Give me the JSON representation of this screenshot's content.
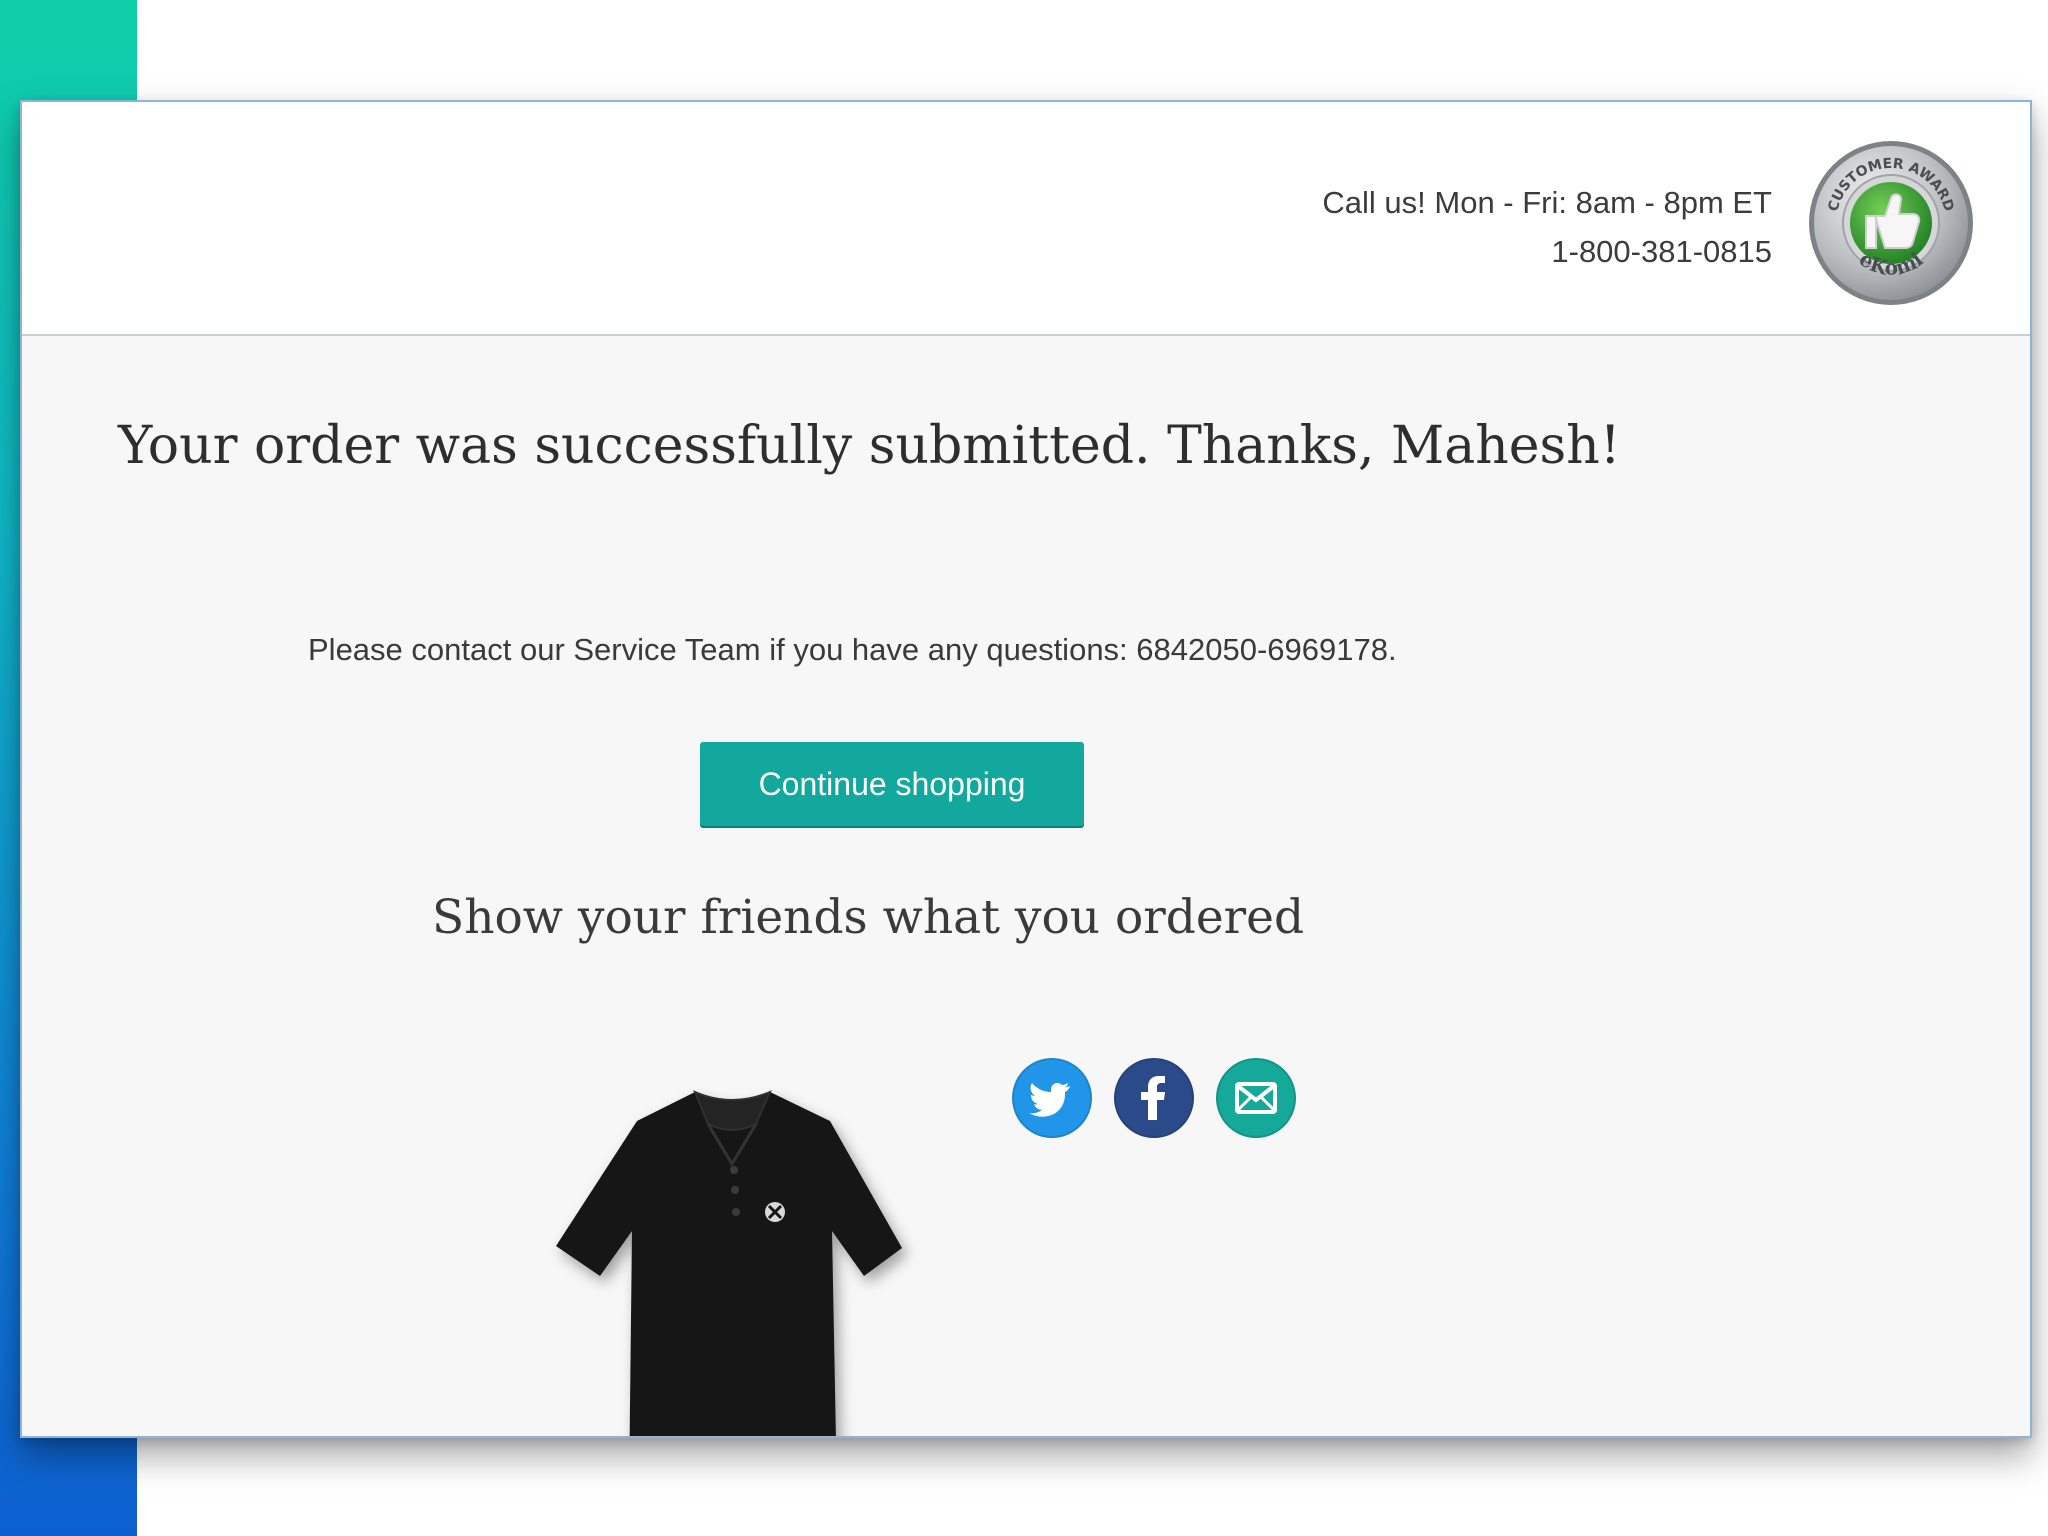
{
  "header": {
    "call_hours": "Call us! Mon - Fri: 8am - 8pm ET",
    "phone": "1-800-381-0815",
    "badge": {
      "top_text": "CUSTOMER AWARD",
      "bottom_text": "eKomi",
      "icon": "thumbs-up-icon"
    }
  },
  "main": {
    "title": "Your order was successfully submitted. Thanks, Mahesh!",
    "contact_note": "Please contact our Service Team if you have any questions: 6842050-6969178.",
    "continue_button": "Continue shopping",
    "share_heading": "Show your friends what you ordered",
    "product": {
      "icon": "black-polo-shirt",
      "color": "#151515"
    },
    "share_buttons": [
      {
        "icon": "twitter-icon",
        "color": "#2196e8"
      },
      {
        "icon": "facebook-icon",
        "color": "#2b4a8a"
      },
      {
        "icon": "mail-icon",
        "color": "#15a99a"
      }
    ]
  },
  "colors": {
    "accent_gradient": [
      "#0fcfa7",
      "#10b7c8",
      "#0f7fd8",
      "#0d5fcf"
    ],
    "button": "#13a89e",
    "page_background": "#f7f7f8"
  }
}
